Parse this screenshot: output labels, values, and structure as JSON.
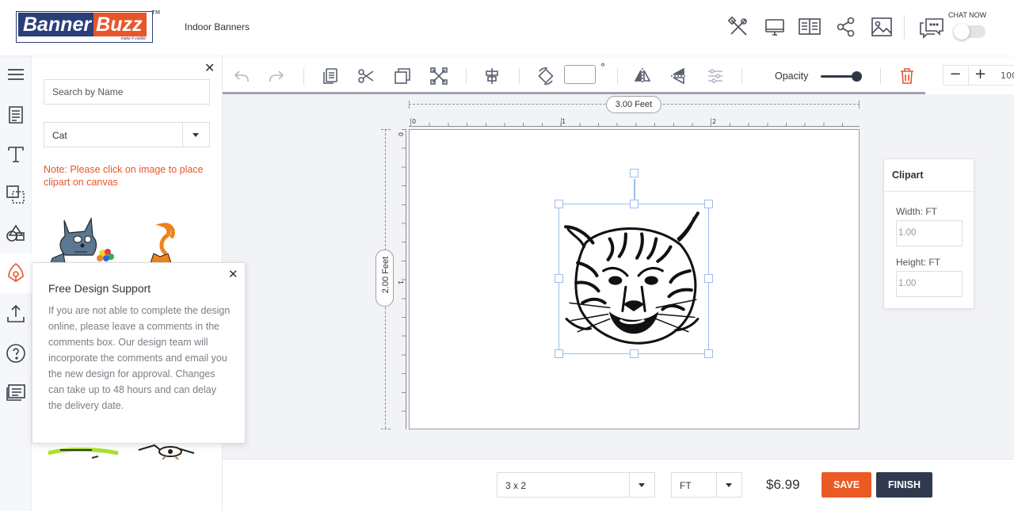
{
  "header": {
    "logo_part1": "Banner",
    "logo_part2": "Buzz",
    "logo_tagline": "make it visible",
    "logo_tm": "TM",
    "title": "Indoor Banners",
    "chat_label": "CHAT NOW",
    "brand_colors": {
      "navy": "#2a3f7a",
      "orange": "#e8552a"
    },
    "icons": [
      "tools-icon",
      "monitor-icon",
      "book-icon",
      "share-icon",
      "image-icon",
      "chat-icon"
    ]
  },
  "rail": {
    "icons": [
      "menu-icon",
      "template-icon",
      "text-icon",
      "layers-icon",
      "shapes-icon",
      "clipart-icon",
      "upload-icon",
      "help-icon",
      "comments-icon"
    ],
    "active": "clipart-icon"
  },
  "panel": {
    "search_placeholder": "Search by Name",
    "category": "Cat",
    "note": "Note: Please click on image to place clipart on canvas"
  },
  "popup": {
    "title": "Free Design Support",
    "body": "If you are not able to complete the design online, please leave a comments in the comments box. Our design team will incorporate the comments and email you the new design for approval. Changes can take up to 48 hours and can delay the delivery date."
  },
  "toolbar": {
    "rotation_value": "",
    "degree_symbol": "°",
    "opacity_label": "Opacity",
    "opacity_value": 1.0,
    "zoom_minus": "−",
    "zoom_plus": "+",
    "zoom_value": "100",
    "icons": [
      "undo-icon",
      "redo-icon",
      "copy-icon",
      "cut-icon",
      "duplicate-icon",
      "crop-icon",
      "align-icon",
      "rotate-icon",
      "flip-horizontal-icon",
      "flip-vertical-icon",
      "adjust-icon",
      "delete-icon"
    ]
  },
  "canvas": {
    "width_label": "3.00 Feet",
    "height_label": "2.00 Feet",
    "ruler_x": [
      "0",
      "1",
      "2"
    ],
    "ruler_y": [
      "0",
      "1"
    ]
  },
  "clipart_panel": {
    "title": "Clipart",
    "width_label": "Width: FT",
    "width_value": "1.00",
    "height_label": "Height: FT",
    "height_value": "1.00"
  },
  "bottom": {
    "size": "3 x 2",
    "unit": "FT",
    "price": "$6.99",
    "save_label": "SAVE",
    "finish_label": "FINISH",
    "save_color": "#ec5a24",
    "finish_color": "#2f3a4e"
  }
}
